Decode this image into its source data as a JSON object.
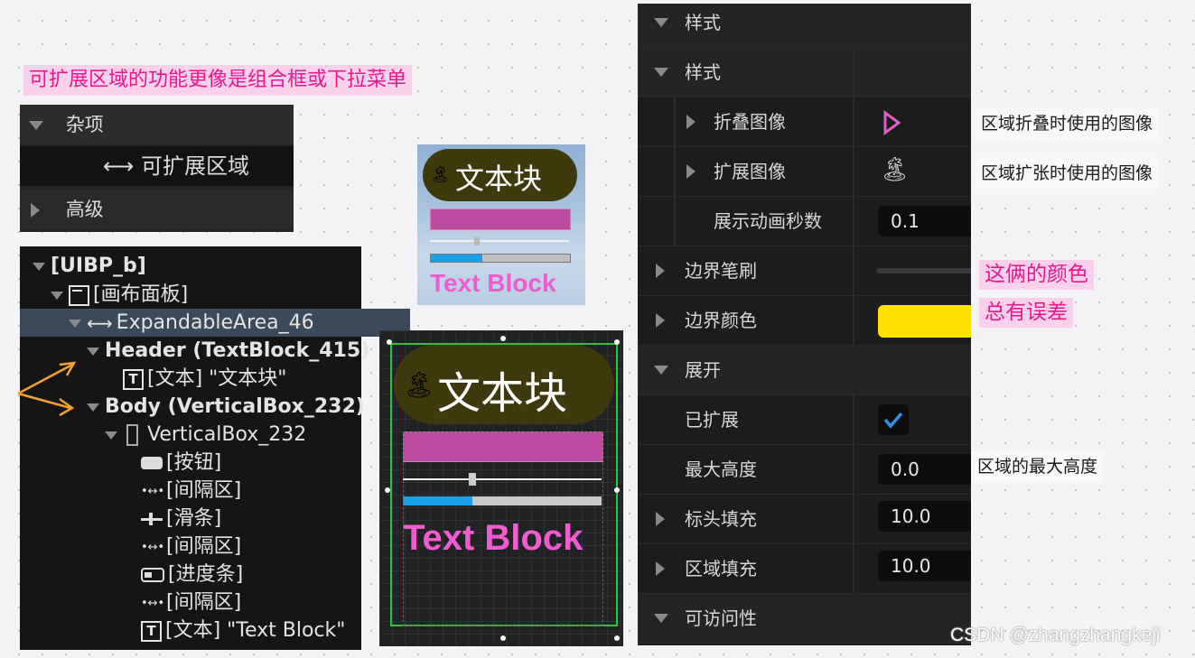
{
  "note_top": "可扩展区域的功能更像是组合框或下拉菜单",
  "misc_panel": {
    "section": "杂项",
    "item": "⟷ 可扩展区域",
    "advanced": "高级"
  },
  "hierarchy": [
    {
      "label": "[UIBP_b]"
    },
    {
      "label": "[画布面板]"
    },
    {
      "label": "ExpandableArea_46"
    },
    {
      "label": "Header (TextBlock_415)"
    },
    {
      "label": "[文本] \"文本块\""
    },
    {
      "label": "Body (VerticalBox_232)"
    },
    {
      "label": "VerticalBox_232"
    },
    {
      "label": "[按钮]"
    },
    {
      "label": "[间隔区]"
    },
    {
      "label": "[滑条]"
    },
    {
      "label": "[间隔区]"
    },
    {
      "label": "[进度条]"
    },
    {
      "label": "[间隔区]"
    },
    {
      "label": "[文本] \"Text Block\""
    }
  ],
  "preview": {
    "header_text": "文本块",
    "body_text": "Text Block",
    "button_color": "#b94a9e",
    "progress_color": "#1aa1e6",
    "text_color": "#f05bd0",
    "slider_value": 0.35,
    "progress_value": 0.37
  },
  "details": {
    "rows": [
      {
        "label": "样式"
      },
      {
        "label": "样式"
      },
      {
        "label": "折叠图像"
      },
      {
        "label": "扩展图像"
      },
      {
        "label": "展示动画秒数",
        "value": "0.1"
      },
      {
        "label": "边界笔刷"
      },
      {
        "label": "边界颜色"
      },
      {
        "label": "展开"
      },
      {
        "label": "已扩展"
      },
      {
        "label": "最大高度",
        "value": "0.0"
      },
      {
        "label": "标头填充",
        "value": "10.0"
      },
      {
        "label": "区域填充",
        "value": "10.0"
      },
      {
        "label": "可访问性"
      }
    ],
    "border_color": "#ffe000"
  },
  "notes": {
    "collapse_image": "区域折叠时使用的图像",
    "expand_image": "区域扩张时使用的图像",
    "color_line1": "这俩的颜色",
    "color_line2": "总有误差",
    "max_height": "区域的最大高度"
  },
  "watermark": "CSDN @zhangzhangkeji"
}
